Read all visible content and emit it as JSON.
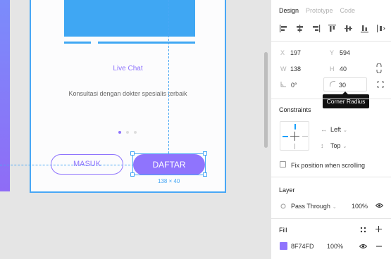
{
  "canvas": {
    "screen": {
      "title": "Live Chat",
      "description": "Konsultasi dengan dokter spesialis terbaik",
      "dots": 3,
      "active_dot": 0
    },
    "buttons": {
      "masuk": "MASUK",
      "daftar": "DAFTAR"
    },
    "selection_size": "138 × 40"
  },
  "panel": {
    "tabs": [
      "Design",
      "Prototype",
      "Code"
    ],
    "active_tab": "Design",
    "alignment_icons": [
      "align-left-icon",
      "align-horizontal-center-icon",
      "align-right-icon",
      "align-top-icon",
      "align-vertical-center-icon",
      "align-bottom-icon",
      "distribute-icon"
    ],
    "props": {
      "x_label": "X",
      "x_value": "197",
      "y_label": "Y",
      "y_value": "594",
      "w_label": "W",
      "w_value": "138",
      "h_label": "H",
      "h_value": "40",
      "rotation_value": "0°",
      "radius_value": "30"
    },
    "tooltip": "Corner Radius",
    "constraints": {
      "title": "Constraints",
      "horizontal": "Left",
      "vertical": "Top",
      "fix_position_label": "Fix position when scrolling"
    },
    "layer": {
      "title": "Layer",
      "blend": "Pass Through",
      "opacity": "100%"
    },
    "fill": {
      "title": "Fill",
      "hex": "8F74FD",
      "opacity": "100%",
      "color": "#8f74fd"
    }
  },
  "colors": {
    "accent": "#8f74fd",
    "selection": "#48a7f5",
    "hero": "#3fa7f3"
  }
}
